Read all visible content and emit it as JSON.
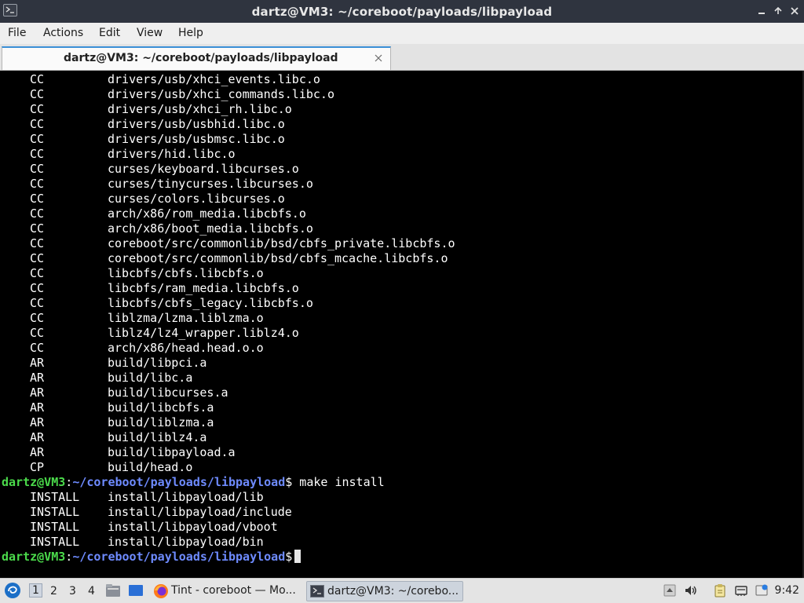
{
  "window": {
    "title": "dartz@VM3: ~/coreboot/payloads/libpayload"
  },
  "menu": [
    "File",
    "Actions",
    "Edit",
    "View",
    "Help"
  ],
  "tab": {
    "label": "dartz@VM3: ~/coreboot/payloads/libpayload"
  },
  "terminal": {
    "build_lines": [
      {
        "tag": "CC",
        "file": "drivers/usb/xhci_events.libc.o"
      },
      {
        "tag": "CC",
        "file": "drivers/usb/xhci_commands.libc.o"
      },
      {
        "tag": "CC",
        "file": "drivers/usb/xhci_rh.libc.o"
      },
      {
        "tag": "CC",
        "file": "drivers/usb/usbhid.libc.o"
      },
      {
        "tag": "CC",
        "file": "drivers/usb/usbmsc.libc.o"
      },
      {
        "tag": "CC",
        "file": "drivers/hid.libc.o"
      },
      {
        "tag": "CC",
        "file": "curses/keyboard.libcurses.o"
      },
      {
        "tag": "CC",
        "file": "curses/tinycurses.libcurses.o"
      },
      {
        "tag": "CC",
        "file": "curses/colors.libcurses.o"
      },
      {
        "tag": "CC",
        "file": "arch/x86/rom_media.libcbfs.o"
      },
      {
        "tag": "CC",
        "file": "arch/x86/boot_media.libcbfs.o"
      },
      {
        "tag": "CC",
        "file": "coreboot/src/commonlib/bsd/cbfs_private.libcbfs.o"
      },
      {
        "tag": "CC",
        "file": "coreboot/src/commonlib/bsd/cbfs_mcache.libcbfs.o"
      },
      {
        "tag": "CC",
        "file": "libcbfs/cbfs.libcbfs.o"
      },
      {
        "tag": "CC",
        "file": "libcbfs/ram_media.libcbfs.o"
      },
      {
        "tag": "CC",
        "file": "libcbfs/cbfs_legacy.libcbfs.o"
      },
      {
        "tag": "CC",
        "file": "liblzma/lzma.liblzma.o"
      },
      {
        "tag": "CC",
        "file": "liblz4/lz4_wrapper.liblz4.o"
      },
      {
        "tag": "CC",
        "file": "arch/x86/head.head.o.o"
      },
      {
        "tag": "AR",
        "file": "build/libpci.a"
      },
      {
        "tag": "AR",
        "file": "build/libc.a"
      },
      {
        "tag": "AR",
        "file": "build/libcurses.a"
      },
      {
        "tag": "AR",
        "file": "build/libcbfs.a"
      },
      {
        "tag": "AR",
        "file": "build/liblzma.a"
      },
      {
        "tag": "AR",
        "file": "build/liblz4.a"
      },
      {
        "tag": "AR",
        "file": "build/libpayload.a"
      },
      {
        "tag": "CP",
        "file": "build/head.o"
      }
    ],
    "prompt1": {
      "user": "dartz@VM3",
      "sep": ":",
      "path": "~/coreboot/payloads/libpayload",
      "symbol": "$",
      "command": " make install"
    },
    "install_lines": [
      {
        "tag": "INSTALL",
        "file": "install/libpayload/lib"
      },
      {
        "tag": "INSTALL",
        "file": "install/libpayload/include"
      },
      {
        "tag": "INSTALL",
        "file": "install/libpayload/vboot"
      },
      {
        "tag": "INSTALL",
        "file": "install/libpayload/bin"
      }
    ],
    "prompt2": {
      "user": "dartz@VM3",
      "sep": ":",
      "path": "~/coreboot/payloads/libpayload",
      "symbol": "$"
    }
  },
  "taskbar": {
    "workspaces": [
      "1",
      "2",
      "3",
      "4"
    ],
    "active_workspace": "1",
    "tasks": [
      {
        "label": "Tint - coreboot — Mo...",
        "icon": "firefox-icon"
      },
      {
        "label": "dartz@VM3: ~/corebo...",
        "icon": "terminal-icon"
      }
    ],
    "clock": "9:42"
  },
  "colors": {
    "prompt_user": "#4bdb4b",
    "prompt_path": "#6e8bff",
    "titlebar_bg": "#2f343f",
    "tab_accent": "#3b8fd6"
  }
}
